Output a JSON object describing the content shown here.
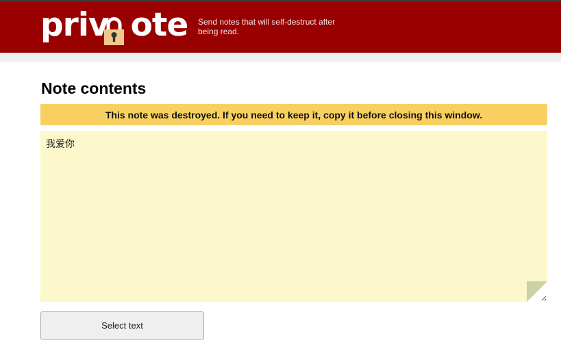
{
  "header": {
    "logo_text": "privnote",
    "tagline": "Send notes that will self-destruct after being read.",
    "colors": {
      "bar": "#990000",
      "lock": "#f0c98a"
    }
  },
  "main": {
    "title": "Note contents",
    "warning": "This note was destroyed. If you need to keep it, copy it before closing this window.",
    "note_text": "我爱你",
    "select_button_label": "Select text",
    "colors": {
      "warning_bg": "#f8d062",
      "note_bg": "#fdf7cc"
    }
  }
}
